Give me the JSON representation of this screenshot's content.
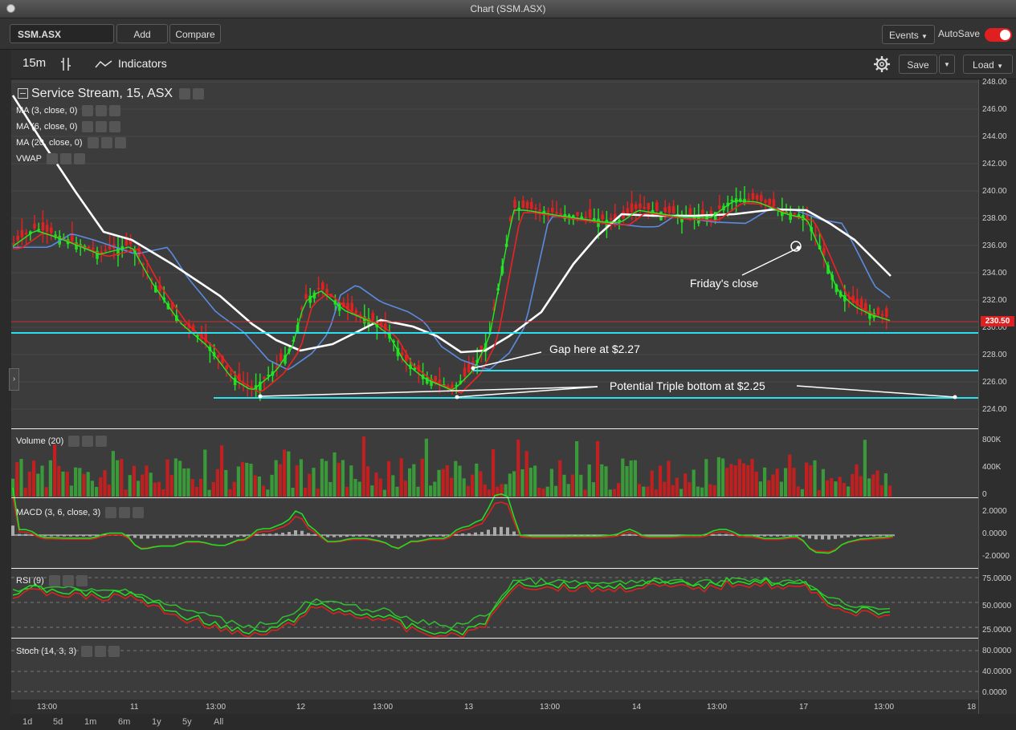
{
  "window": {
    "title": "Chart (SSM.ASX)"
  },
  "topbar": {
    "symbol": "SSM.ASX",
    "add_label": "Add",
    "compare_label": "Compare",
    "events_label": "Events",
    "autosave_label": "AutoSave",
    "autosave_on": true
  },
  "toolbar": {
    "interval": "15m",
    "indicators_label": "Indicators",
    "save_label": "Save",
    "load_label": "Load"
  },
  "chart": {
    "title": "Service Stream, 15, ASX",
    "studies": [
      "MA (3, close, 0)",
      "MA (6, close, 0)",
      "MA (20, close, 0)",
      "VWAP"
    ],
    "last_price_tag": "230.50",
    "price_ticks": [
      "248.00",
      "246.00",
      "244.00",
      "242.00",
      "240.00",
      "238.00",
      "236.00",
      "234.00",
      "232.00",
      "230.00",
      "228.00",
      "226.00",
      "224.00"
    ],
    "annotations": {
      "fridays_close": "Friday's close",
      "gap": "Gap here at $2.27",
      "triple_bottom": "Potential Triple bottom at $2.25"
    },
    "colors": {
      "background": "#3c3c3c",
      "up": "#22dd22",
      "down": "#dd2222",
      "ma3": "#22ee22",
      "ma6": "#ee2222",
      "ma20": "#ffffff",
      "vwap": "#5b8be0",
      "support_line": "#28e0f0"
    }
  },
  "panels": {
    "volume": {
      "label": "Volume (20)",
      "ticks": [
        "800K",
        "400K",
        "0"
      ]
    },
    "macd": {
      "label": "MACD (3, 6, close, 3)",
      "ticks": [
        "2.0000",
        "0.0000",
        "-2.0000"
      ]
    },
    "rsi": {
      "label": "RSI (9)",
      "ticks": [
        "75.0000",
        "50.0000",
        "25.0000"
      ]
    },
    "stoch": {
      "label": "Stoch (14, 3, 3)",
      "ticks": [
        "80.0000",
        "40.0000",
        "0.0000"
      ]
    }
  },
  "xaxis": {
    "labels": [
      "13:00",
      "11",
      "13:00",
      "12",
      "13:00",
      "13",
      "13:00",
      "14",
      "13:00",
      "17",
      "13:00",
      "18"
    ]
  },
  "ranges": [
    "1d",
    "5d",
    "1m",
    "6m",
    "1y",
    "5y",
    "All"
  ]
}
